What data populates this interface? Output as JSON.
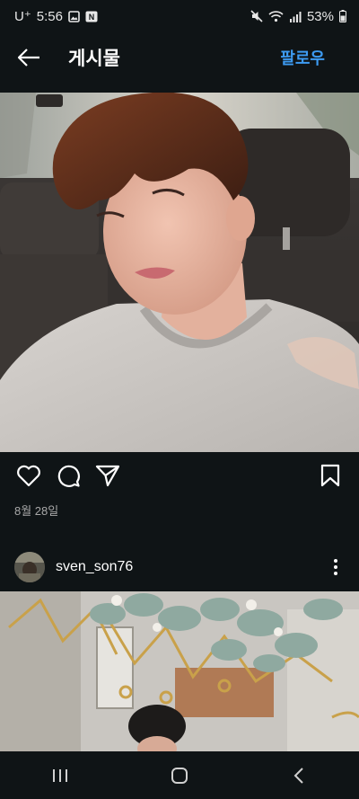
{
  "status_bar": {
    "carrier": "U⁺",
    "time": "5:56",
    "battery": "53%",
    "icons_left": [
      "gallery-notification-icon",
      "app-notification-icon"
    ],
    "icons_right": [
      "mute-icon",
      "wifi-icon",
      "signal-icon",
      "battery-icon"
    ]
  },
  "app_bar": {
    "title": "게시물",
    "follow_label": "팔로우",
    "accent_color": "#3d9bf2"
  },
  "post": {
    "photo_subject": "young man in grey sweatshirt in car back seat",
    "actions": [
      "like",
      "comment",
      "share",
      "save"
    ],
    "date": "8월 28일"
  },
  "next_post": {
    "username": "sven_son76",
    "photo_subject": "cafe interior with eucalyptus and gold wire decor, person below"
  },
  "nav_bar": {
    "buttons": [
      "recents",
      "home",
      "back"
    ]
  }
}
